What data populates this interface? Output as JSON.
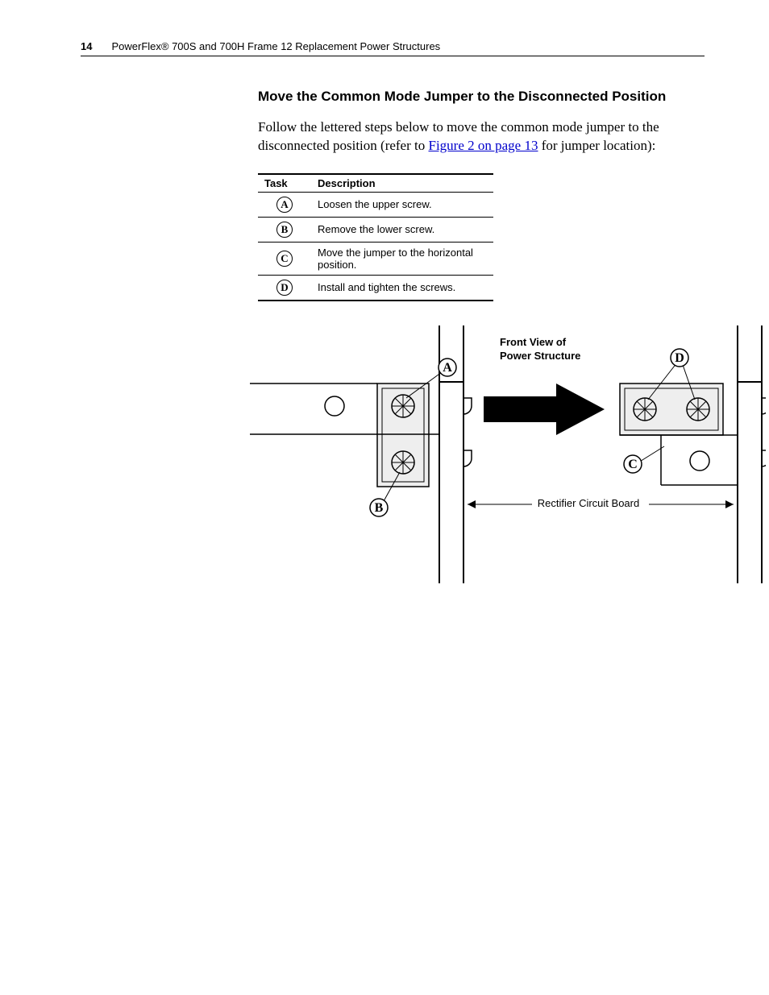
{
  "header": {
    "page_number": "14",
    "doc_title": "PowerFlex® 700S and 700H Frame 12 Replacement Power Structures"
  },
  "section": {
    "title": "Move the Common Mode Jumper to the Disconnected Position",
    "intro_before_link": "Follow the lettered steps below to move the common mode jumper to the disconnected position (refer to ",
    "link_text": "Figure 2 on page 13",
    "intro_after_link": " for jumper location):"
  },
  "table": {
    "headers": {
      "task": "Task",
      "desc": "Description"
    },
    "rows": [
      {
        "task": "A",
        "desc": "Loosen the upper screw."
      },
      {
        "task": "B",
        "desc": "Remove the lower screw."
      },
      {
        "task": "C",
        "desc": "Move the jumper to the horizontal position."
      },
      {
        "task": "D",
        "desc": "Install and tighten the screws."
      }
    ]
  },
  "figure": {
    "title_line1": "Front View of",
    "title_line2": "Power Structure",
    "caption": "Rectifier Circuit Board",
    "labels": {
      "A": "A",
      "B": "B",
      "C": "C",
      "D": "D"
    }
  }
}
